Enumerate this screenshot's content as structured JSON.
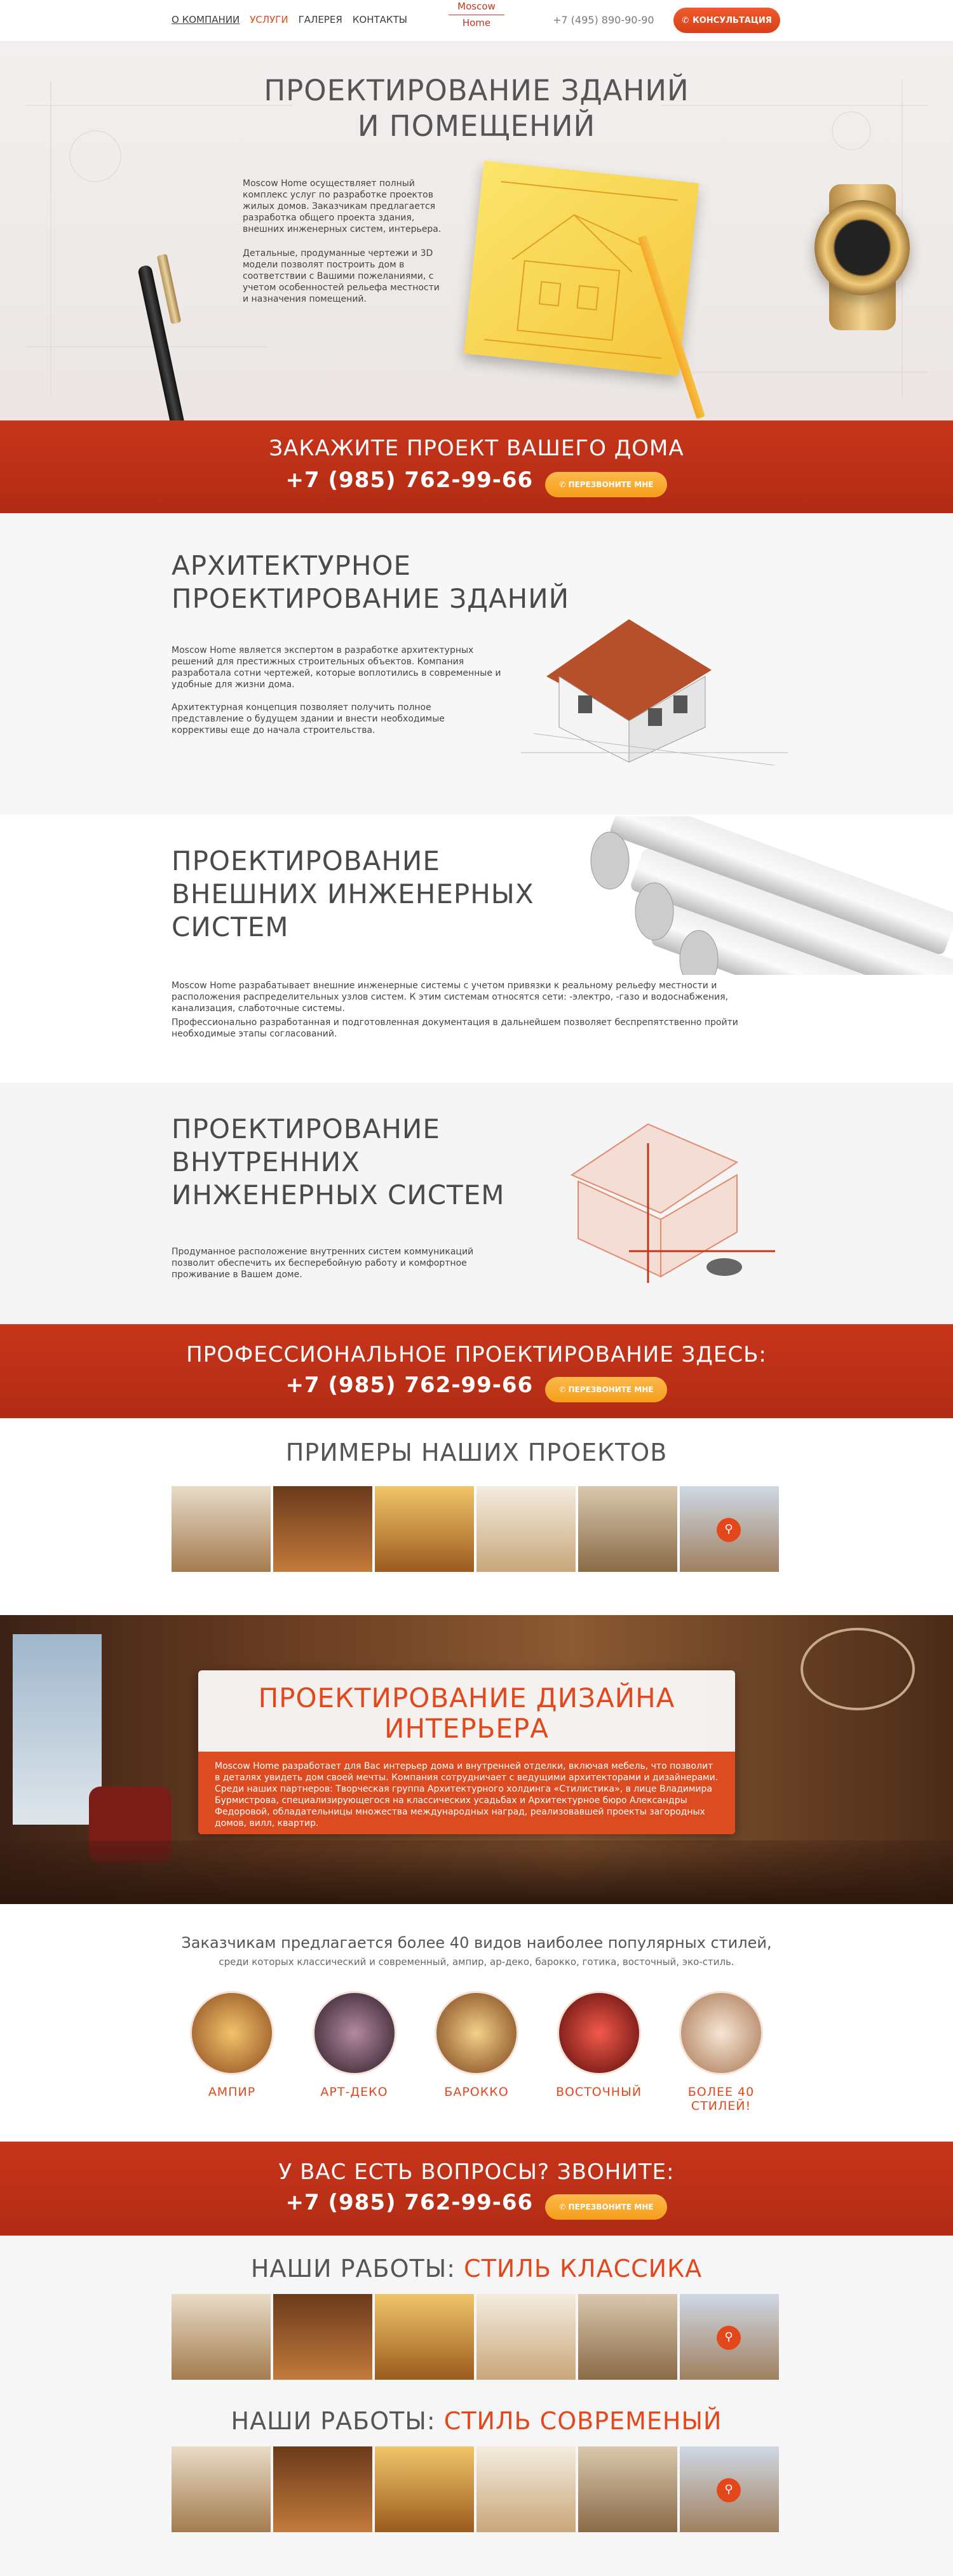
{
  "header": {
    "nav": [
      "О КОМПАНИИ",
      "УСЛУГИ",
      "ГАЛЕРЕЯ",
      "КОНТАКТЫ"
    ],
    "logo_top": "Moscow",
    "logo_bottom": "Home",
    "phone": "+7 (495) 890-90-90",
    "consult_button": "КОНСУЛЬТАЦИЯ"
  },
  "hero": {
    "title_line1": "ПРОЕКТИРОВАНИЕ ЗДАНИЙ",
    "title_line2": "И ПОМЕЩЕНИЙ",
    "p1": "Moscow Home осуществляет полный комплекс услуг по разработке проектов жилых домов. Заказчикам предлагается разработка общего проекта здания, внешних инженерных систем, интерьера.",
    "p2": "Детальные, продуманные чертежи и 3D модели позволят построить дом в соответствии с Вашими пожеланиями, с учетом особенностей рельефа местности и назначения помещений."
  },
  "cta1": {
    "title": "ЗАКАЖИТЕ ПРОЕКТ ВАШЕГО ДОМА",
    "phone": "+7 (985) 762-99-66",
    "button": "ПЕРЕЗВОНИТЕ МНЕ"
  },
  "arch": {
    "title_line1": "АРХИТЕКТУРНОЕ",
    "title_line2": "ПРОЕКТИРОВАНИЕ ЗДАНИЙ",
    "p1": "Moscow Home является экспертом в разработке архитектурных решений для престижных строительных объектов. Компания разработала сотни чертежей, которые воплотились в современные и удобные для жизни дома.",
    "p2": "Архитектурная концепция позволяет получить полное представление о будущем здании и внести необходимые коррективы еще до начала строительства."
  },
  "external": {
    "title_line1": "ПРОЕКТИРОВАНИЕ",
    "title_line2": "ВНЕШНИХ ИНЖЕНЕРНЫХ",
    "title_line3": "СИСТЕМ",
    "p1": "Moscow Home разрабатывает внешние инженерные системы с учетом привязки к реальному рельефу местности и расположения распределительных узлов систем. К этим системам относятся сети: -электро, -газо и водоснабжения, канализация, слаботочные системы.",
    "p2": "Профессионально разработанная и подготовленная документация в дальнейшем позволяет беспрепятственно пройти необходимые этапы согласований."
  },
  "internal": {
    "title_line1": "ПРОЕКТИРОВАНИЕ",
    "title_line2": "ВНУТРЕННИХ",
    "title_line3": "ИНЖЕНЕРНЫХ СИСТЕМ",
    "p1": "Продуманное расположение внутренних систем коммуникаций позволит обеспечить их бесперебойную работу и комфортное проживание в Вашем доме."
  },
  "cta2": {
    "title": "ПРОФЕССИОНАЛЬНОЕ ПРОЕКТИРОВАНИЕ ЗДЕСЬ:",
    "phone": "+7 (985) 762-99-66",
    "button": "ПЕРЕЗВОНИТЕ МНЕ"
  },
  "examples_title": "ПРИМЕРЫ НАШИХ ПРОЕКТОВ",
  "interior": {
    "title_line1": "ПРОЕКТИРОВАНИЕ ДИЗАЙНА",
    "title_line2": "ИНТЕРЬЕРА",
    "text": "Moscow Home разработает для Вас интерьер дома и внутренней отделки, включая мебель, что позволит в деталях увидеть дом своей мечты. Компания сотрудничает с ведущими архитекторами и дизайнерами. Среди наших партнеров: Творческая группа Архитектурного холдинга «Стилистика», в лице Владимира Бурмистрова, специализирующегося на классических усадьбах и Архитектурное бюро Александры Федоровой, обладательницы множества международных наград, реализовавшей проекты загородных домов, вилл, квартир."
  },
  "styles_intro": {
    "line1": "Заказчикам предлагается более 40 видов наиболее популярных стилей,",
    "line2": "среди которых классический и современный, ампир, ар-деко, барокко, готика, восточный, эко-стиль."
  },
  "styles": [
    {
      "line1": "АМПИР",
      "line2": ""
    },
    {
      "line1": "АРТ-ДЕКО",
      "line2": ""
    },
    {
      "line1": "БАРОККО",
      "line2": ""
    },
    {
      "line1": "ВОСТОЧНЫЙ",
      "line2": ""
    },
    {
      "line1": "БОЛЕЕ 40",
      "line2": "СТИЛЕЙ!"
    }
  ],
  "cta3": {
    "title": "У ВАС ЕСТЬ ВОПРОСЫ? ЗВОНИТЕ:",
    "phone": "+7 (985) 762-99-66",
    "button": "ПЕРЕЗВОНИТЕ МНЕ"
  },
  "works1": {
    "prefix": "НАШИ РАБОТЫ: ",
    "accent": "СТИЛЬ КЛАССИКА"
  },
  "works2": {
    "prefix": "НАШИ РАБОТЫ: ",
    "accent": "СТИЛЬ СОВРЕМЕНЫЙ"
  },
  "colors": {
    "accent": "#e3481d",
    "red_band": "#b82e16",
    "callback": "#f7a325"
  }
}
